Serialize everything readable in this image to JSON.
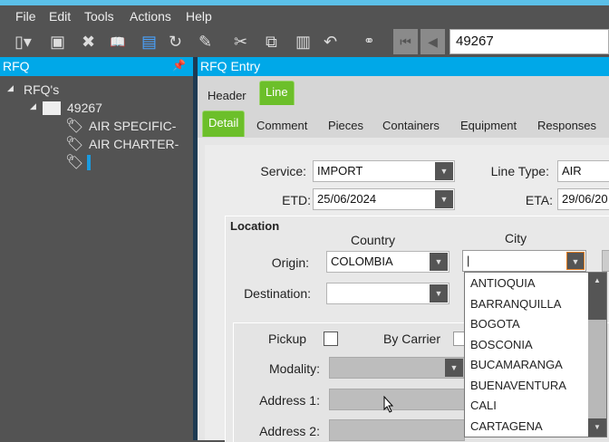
{
  "menu": [
    "File",
    "Edit",
    "Tools",
    "Actions",
    "Help"
  ],
  "toolbar": {
    "record_value": "49267"
  },
  "left_panel": {
    "title": "RFQ",
    "tree": {
      "root": "RFQ's",
      "folder": "49267",
      "items": [
        "AIR SPECIFIC-",
        "AIR CHARTER-",
        ""
      ]
    }
  },
  "main": {
    "title": "RFQ Entry",
    "tabs": [
      "Header",
      "Line"
    ],
    "subtabs": [
      "Detail",
      "Comment",
      "Pieces",
      "Containers",
      "Equipment",
      "Responses"
    ],
    "form": {
      "service_label": "Service:",
      "service": "IMPORT",
      "line_type_label": "Line Type:",
      "line_type": "AIR",
      "etd_label": "ETD:",
      "etd": "25/06/2024",
      "eta_label": "ETA:",
      "eta": "29/06/20",
      "location": {
        "title": "Location",
        "country_header": "Country",
        "city_header": "City",
        "origin_label": "Origin:",
        "origin_country": "COLOMBIA",
        "origin_city": "|",
        "destination_label": "Destination:",
        "destination_country": ""
      },
      "pickup_label": "Pickup",
      "by_carrier_label": "By Carrier",
      "modality_label": "Modality:",
      "address1_label": "Address 1:",
      "address2_label": "Address 2:"
    },
    "city_options": [
      "ANTIOQUIA",
      "BARRANQUILLA",
      "BOGOTA",
      "BOSCONIA",
      "BUCAMARANGA",
      "BUENAVENTURA",
      "CALI",
      "CARTAGENA"
    ]
  },
  "colors": {
    "accent": "#00a8e8",
    "tab_active": "#6cbf2a"
  }
}
